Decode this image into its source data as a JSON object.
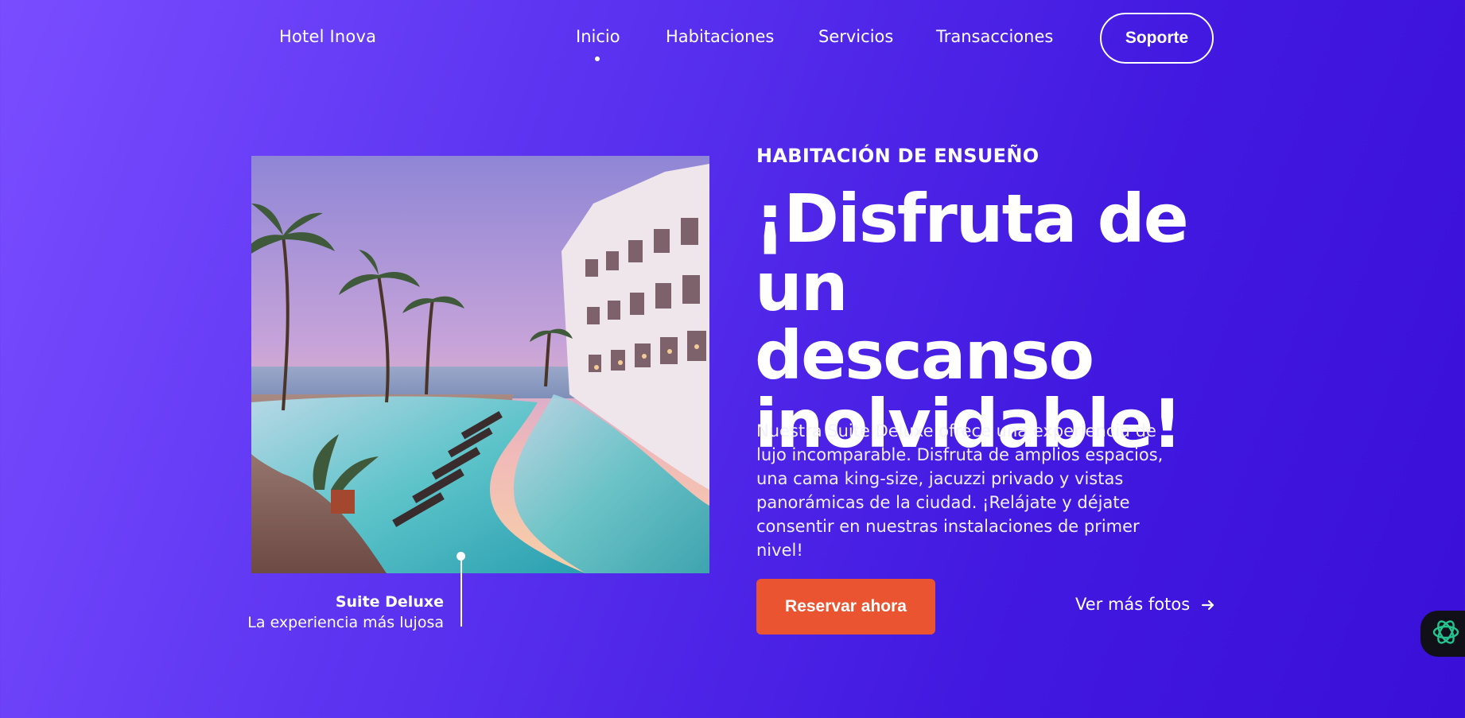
{
  "header": {
    "brand": "Hotel Inova",
    "nav": [
      {
        "label": "Inicio",
        "active": true
      },
      {
        "label": "Habitaciones",
        "active": false
      },
      {
        "label": "Servicios",
        "active": false
      },
      {
        "label": "Transacciones",
        "active": false
      }
    ],
    "support_label": "Soporte"
  },
  "hero": {
    "eyebrow": "HABITACIÓN DE ENSUEÑO",
    "headline_lines": [
      "¡Disfruta de",
      "un descanso",
      "inolvidable!"
    ],
    "description": "Nuestra Suite Deluxe ofrece una experiencia de lujo incomparable. Disfruta de amplios espacios, una cama king-size, jacuzzi privado y vistas panorámicas de la ciudad. ¡Relájate y déjate consentir en nuestras instalaciones de primer nivel!",
    "reserve_label": "Reservar ahora",
    "more_photos_label": "Ver más fotos",
    "image_caption": {
      "title": "Suite Deluxe",
      "subtitle": "La experiencia más lujosa"
    }
  },
  "icons": {
    "more_photos": "arrow-right-icon",
    "assistant": "assistant-knot-icon"
  },
  "colors": {
    "background_start": "#7a4dff",
    "background_end": "#3a10d8",
    "cta": "#ea5430",
    "assistant_accent": "#23c48e"
  }
}
